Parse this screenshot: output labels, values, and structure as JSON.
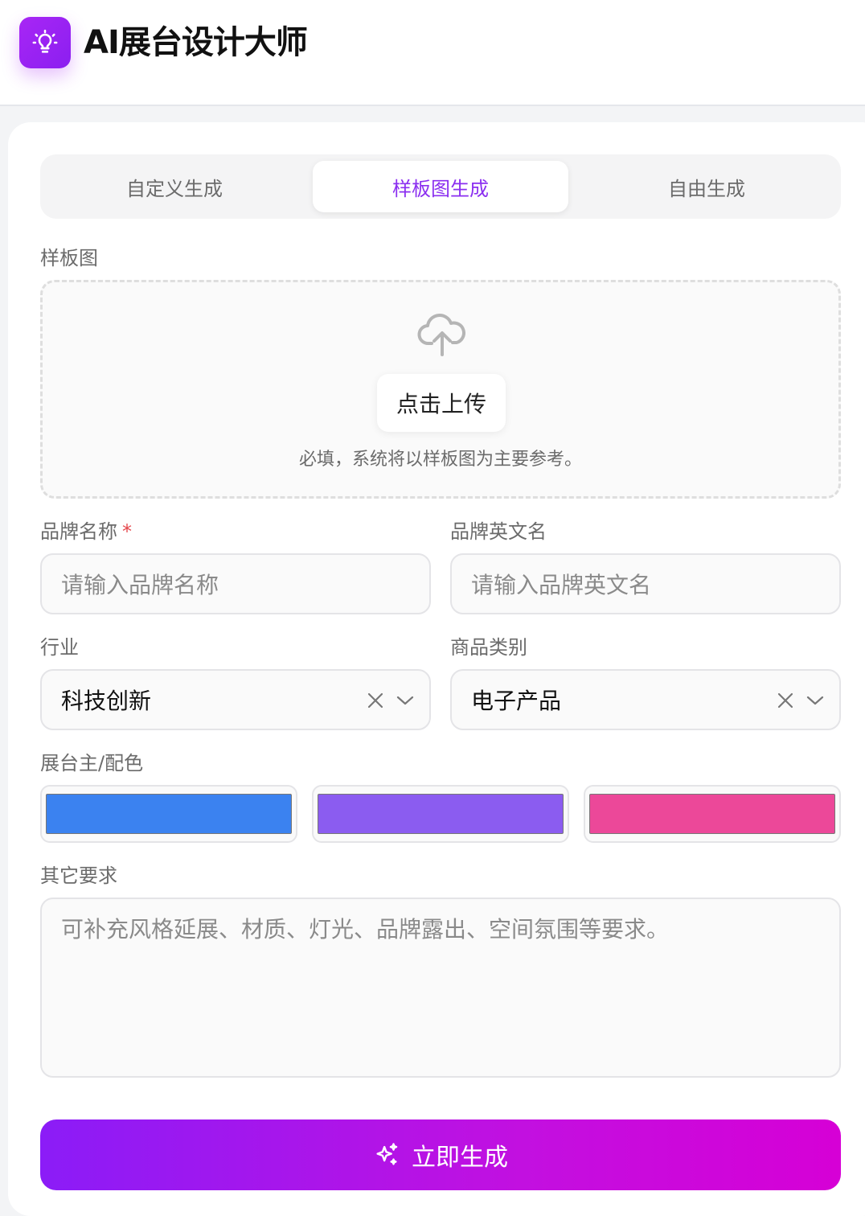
{
  "app": {
    "title": "AI展台设计大师",
    "logo_icon": "lightbulb-icon"
  },
  "tabs": [
    {
      "label": "自定义生成",
      "active": false
    },
    {
      "label": "样板图生成",
      "active": true
    },
    {
      "label": "自由生成",
      "active": false
    }
  ],
  "template_image": {
    "label": "样板图",
    "upload_icon": "cloud-upload-icon",
    "upload_button": "点击上传",
    "hint": "必填，系统将以样板图为主要参考。"
  },
  "brand_name": {
    "label": "品牌名称",
    "required_mark": "*",
    "placeholder": "请输入品牌名称",
    "value": ""
  },
  "brand_english_name": {
    "label": "品牌英文名",
    "placeholder": "请输入品牌英文名",
    "value": ""
  },
  "industry": {
    "label": "行业",
    "value": "科技创新"
  },
  "product_category": {
    "label": "商品类别",
    "value": "电子产品"
  },
  "colors": {
    "label": "展台主/配色",
    "swatches": [
      "#3b82f0",
      "#8b5cf0",
      "#ec4899"
    ]
  },
  "other_requirements": {
    "label": "其它要求",
    "placeholder": "可补充风格延展、材质、灯光、品牌露出、空间氛围等要求。",
    "value": ""
  },
  "submit": {
    "label": "立即生成",
    "icon": "sparkles-icon"
  },
  "theme": {
    "accent": "#8b2ff0",
    "gradient_start": "#8b1cf7",
    "gradient_end": "#d600d6"
  }
}
